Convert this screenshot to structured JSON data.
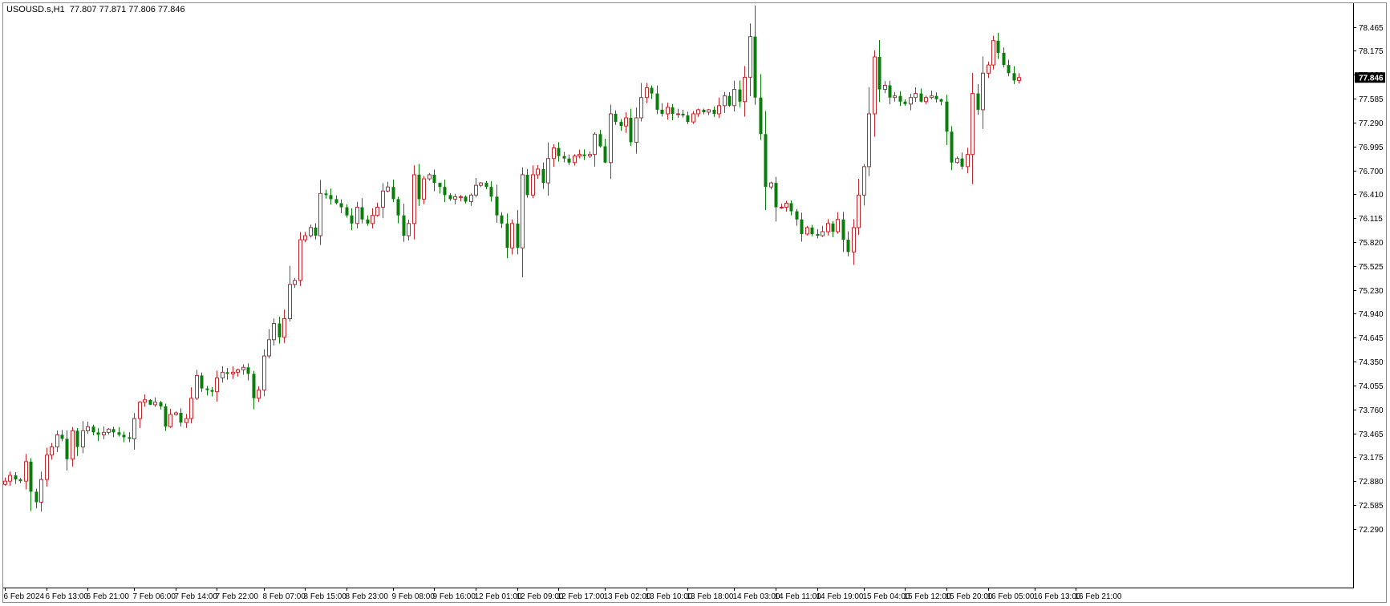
{
  "header": {
    "symbol": "USOUSD.s,H1",
    "ohlc": "77.807 77.871 77.806 77.846"
  },
  "colors": {
    "bull": "#c0282d",
    "bear": "#0b7d0b",
    "frame": "#8a8a8a",
    "price_label_bg": "#000000",
    "price_label_text": "#ffffff"
  },
  "chart_data": {
    "type": "candlestick",
    "grid": false,
    "current_price": 77.846,
    "current_price_label": "77.846",
    "ylim": [
      72.29,
      78.61
    ],
    "y_ticks": [
      "78.465",
      "78.175",
      "77.880",
      "77.585",
      "77.290",
      "76.995",
      "76.700",
      "76.410",
      "76.115",
      "75.820",
      "75.525",
      "75.230",
      "74.940",
      "74.645",
      "74.350",
      "74.055",
      "73.760",
      "73.465",
      "73.175",
      "72.880",
      "72.585",
      "72.290"
    ],
    "x_ticks": [
      {
        "bar": 0,
        "label": "6 Feb 2024"
      },
      {
        "bar": 8,
        "label": "6 Feb 13:00"
      },
      {
        "bar": 16,
        "label": "6 Feb 21:00"
      },
      {
        "bar": 25,
        "label": "7 Feb 06:00"
      },
      {
        "bar": 33,
        "label": "7 Feb 14:00"
      },
      {
        "bar": 41,
        "label": "7 Feb 22:00"
      },
      {
        "bar": 50,
        "label": "8 Feb 07:00"
      },
      {
        "bar": 58,
        "label": "8 Feb 15:00"
      },
      {
        "bar": 66,
        "label": "8 Feb 23:00"
      },
      {
        "bar": 75,
        "label": "9 Feb 08:00"
      },
      {
        "bar": 83,
        "label": "9 Feb 16:00"
      },
      {
        "bar": 91,
        "label": "12 Feb 01:00"
      },
      {
        "bar": 99,
        "label": "12 Feb 09:00"
      },
      {
        "bar": 107,
        "label": "12 Feb 17:00"
      },
      {
        "bar": 116,
        "label": "13 Feb 02:00"
      },
      {
        "bar": 124,
        "label": "13 Feb 10:00"
      },
      {
        "bar": 132,
        "label": "13 Feb 18:00"
      },
      {
        "bar": 141,
        "label": "14 Feb 03:00"
      },
      {
        "bar": 149,
        "label": "14 Feb 11:00"
      },
      {
        "bar": 157,
        "label": "14 Feb 19:00"
      },
      {
        "bar": 166,
        "label": "15 Feb 04:00"
      },
      {
        "bar": 174,
        "label": "15 Feb 12:00"
      },
      {
        "bar": 182,
        "label": "15 Feb 20:00"
      },
      {
        "bar": 190,
        "label": "16 Feb 05:00"
      },
      {
        "bar": 199,
        "label": "16 Feb 13:00"
      },
      {
        "bar": 207,
        "label": "16 Feb 21:00"
      }
    ],
    "closes": [
      72.88,
      72.95,
      72.9,
      72.88,
      73.12,
      72.75,
      72.62,
      72.9,
      73.2,
      73.3,
      73.45,
      73.4,
      73.15,
      73.5,
      73.3,
      73.5,
      73.55,
      73.48,
      73.45,
      73.48,
      73.52,
      73.48,
      73.45,
      73.42,
      73.4,
      73.65,
      73.85,
      73.88,
      73.82,
      73.85,
      73.8,
      73.55,
      73.7,
      73.72,
      73.6,
      73.65,
      73.9,
      74.18,
      74.02,
      74.0,
      73.98,
      74.15,
      74.22,
      74.2,
      74.22,
      74.25,
      74.28,
      74.2,
      73.9,
      74.0,
      74.42,
      74.62,
      74.82,
      74.65,
      74.88,
      75.3,
      75.35,
      75.85,
      75.9,
      76.0,
      75.9,
      76.42,
      76.4,
      76.35,
      76.3,
      76.25,
      76.15,
      76.05,
      76.25,
      76.1,
      76.05,
      76.15,
      76.25,
      76.45,
      76.5,
      76.35,
      76.15,
      75.9,
      76.05,
      76.65,
      76.35,
      76.6,
      76.65,
      76.55,
      76.5,
      76.4,
      76.35,
      76.38,
      76.38,
      76.32,
      76.4,
      76.52,
      76.55,
      76.5,
      76.38,
      76.15,
      76.05,
      75.75,
      76.05,
      75.75,
      76.65,
      76.4,
      76.65,
      76.72,
      76.55,
      76.85,
      76.98,
      76.88,
      76.85,
      76.8,
      76.88,
      76.9,
      76.88,
      76.9,
      77.15,
      77.0,
      76.8,
      77.4,
      77.3,
      77.25,
      77.35,
      77.05,
      77.35,
      77.6,
      77.72,
      77.65,
      77.45,
      77.4,
      77.48,
      77.4,
      77.4,
      77.38,
      77.3,
      77.4,
      77.45,
      77.42,
      77.45,
      77.4,
      77.5,
      77.62,
      77.5,
      77.7,
      77.55,
      77.85,
      78.35,
      77.6,
      77.15,
      76.5,
      76.55,
      76.25,
      76.25,
      76.3,
      76.2,
      76.1,
      75.92,
      76.0,
      75.92,
      75.9,
      75.95,
      76.05,
      75.95,
      76.1,
      75.85,
      75.7,
      76.0,
      76.4,
      76.75,
      77.4,
      78.1,
      77.7,
      77.75,
      77.6,
      77.62,
      77.55,
      77.52,
      77.6,
      77.65,
      77.55,
      77.6,
      77.62,
      77.58,
      77.55,
      77.18,
      76.8,
      76.85,
      76.75,
      76.9,
      77.65,
      77.45,
      77.9,
      78.0,
      78.3,
      78.15,
      78.0,
      77.9,
      77.81,
      77.846
    ]
  }
}
